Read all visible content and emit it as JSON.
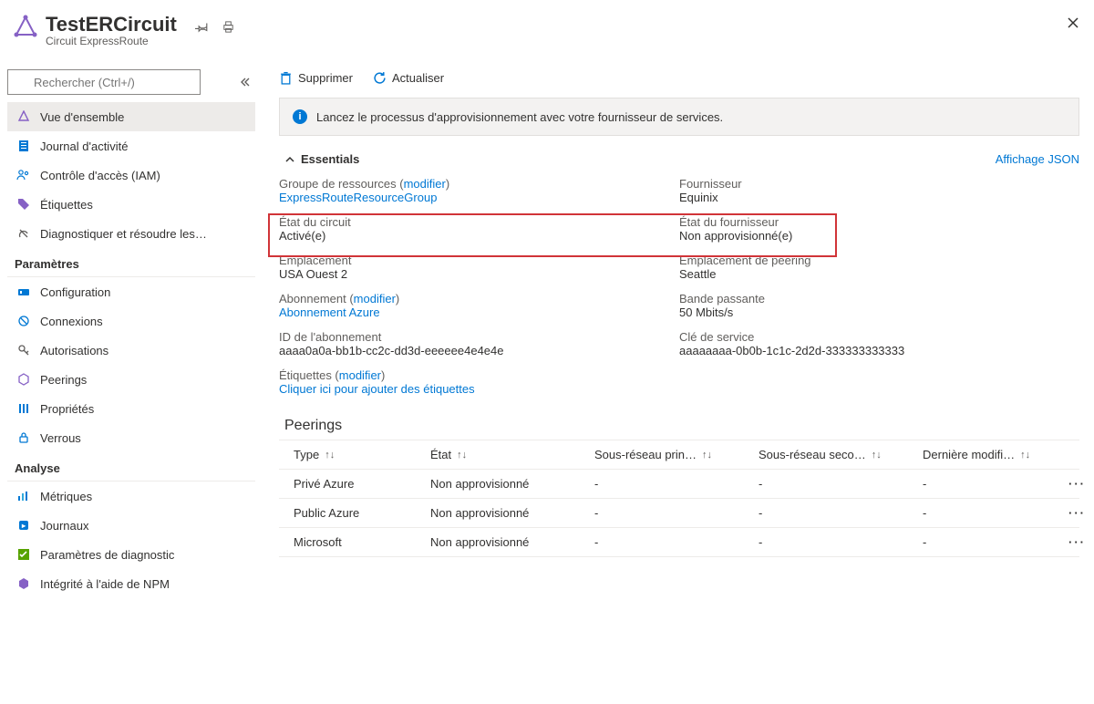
{
  "header": {
    "title": "TestERCircuit",
    "subtitle": "Circuit ExpressRoute"
  },
  "search": {
    "placeholder": "Rechercher (Ctrl+/)"
  },
  "nav": {
    "overview": "Vue d'ensemble",
    "activity": "Journal d'activité",
    "iam": "Contrôle d'accès (IAM)",
    "tags": "Étiquettes",
    "diag": "Diagnostiquer et résoudre les…",
    "sec_params": "Paramètres",
    "config": "Configuration",
    "connections": "Connexions",
    "auth": "Autorisations",
    "peerings": "Peerings",
    "props": "Propriétés",
    "locks": "Verrous",
    "sec_analysis": "Analyse",
    "metrics": "Métriques",
    "logs": "Journaux",
    "diag_settings": "Paramètres de diagnostic",
    "npm": "Intégrité à l'aide de NPM"
  },
  "toolbar": {
    "delete": "Supprimer",
    "refresh": "Actualiser"
  },
  "info": "Lancez le processus d'approvisionnement avec votre fournisseur de services.",
  "essentials": {
    "title": "Essentials",
    "json": "Affichage JSON",
    "rg_label": "Groupe de ressources  (",
    "modify": "modifier",
    "close_paren": ")",
    "rg_value": "ExpressRouteResourceGroup",
    "circuit_state_label": "État du circuit",
    "circuit_state_value": "Activé(e)",
    "location_label": "Emplacement",
    "location_value": "USA Ouest 2",
    "sub_label": "Abonnement (",
    "sub_value": "Abonnement Azure",
    "subid_label": "ID de l'abonnement",
    "subid_value": "aaaa0a0a-bb1b-cc2c-dd3d-eeeeee4e4e4e",
    "tags_label": "Étiquettes (",
    "tags_value": "Cliquer ici pour ajouter des étiquettes",
    "provider_label": "Fournisseur",
    "provider_value": "Equinix",
    "provstate_label": "État du fournisseur",
    "provstate_value": "Non approvisionné(e)",
    "peerloc_label": "Emplacement de peering",
    "peerloc_value": "Seattle",
    "bw_label": "Bande passante",
    "bw_value": "50 Mbits/s",
    "skey_label": "Clé de service",
    "skey_value": "aaaaaaaa-0b0b-1c1c-2d2d-333333333333"
  },
  "peerings": {
    "title": "Peerings",
    "cols": {
      "type": "Type",
      "state": "État",
      "subp": "Sous-réseau prin…",
      "subs": "Sous-réseau seco…",
      "last": "Dernière modifi…"
    },
    "rows": [
      {
        "type": "Privé Azure",
        "state": "Non approvisionné",
        "subp": "-",
        "subs": "-",
        "last": "-"
      },
      {
        "type": "Public Azure",
        "state": "Non approvisionné",
        "subp": "-",
        "subs": "-",
        "last": "-"
      },
      {
        "type": "Microsoft",
        "state": "Non approvisionné",
        "subp": "-",
        "subs": "-",
        "last": "-"
      }
    ]
  }
}
